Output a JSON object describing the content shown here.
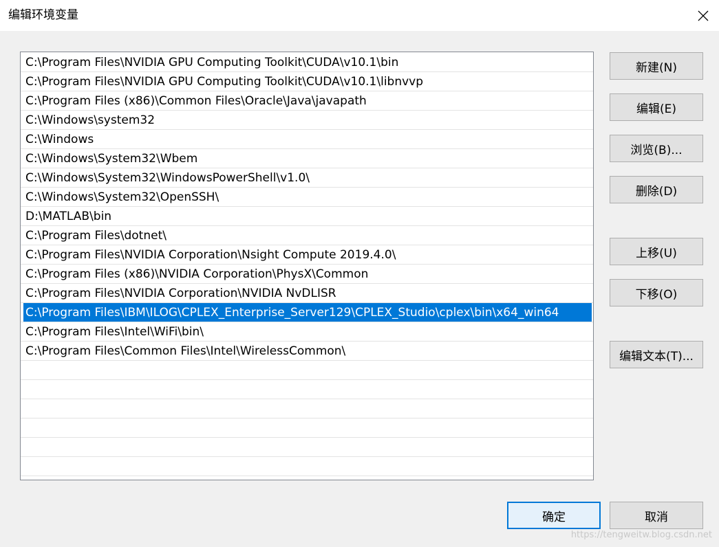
{
  "window": {
    "title": "编辑环境变量",
    "close_icon": "close-icon"
  },
  "path_list": {
    "items": [
      "C:\\Program Files\\NVIDIA GPU Computing Toolkit\\CUDA\\v10.1\\bin",
      "C:\\Program Files\\NVIDIA GPU Computing Toolkit\\CUDA\\v10.1\\libnvvp",
      "C:\\Program Files (x86)\\Common Files\\Oracle\\Java\\javapath",
      "C:\\Windows\\system32",
      "C:\\Windows",
      "C:\\Windows\\System32\\Wbem",
      "C:\\Windows\\System32\\WindowsPowerShell\\v1.0\\",
      "C:\\Windows\\System32\\OpenSSH\\",
      "D:\\MATLAB\\bin",
      "C:\\Program Files\\dotnet\\",
      "C:\\Program Files\\NVIDIA Corporation\\Nsight Compute 2019.4.0\\",
      "C:\\Program Files (x86)\\NVIDIA Corporation\\PhysX\\Common",
      "C:\\Program Files\\NVIDIA Corporation\\NVIDIA NvDLISR",
      "C:\\Program Files\\IBM\\ILOG\\CPLEX_Enterprise_Server129\\CPLEX_Studio\\cplex\\bin\\x64_win64",
      "C:\\Program Files\\Intel\\WiFi\\bin\\",
      "C:\\Program Files\\Common Files\\Intel\\WirelessCommon\\",
      "",
      "",
      "",
      "",
      "",
      "",
      ""
    ],
    "selected_index": 13,
    "selected_color": "#0078d7"
  },
  "buttons": {
    "new": "新建(N)",
    "edit": "编辑(E)",
    "browse": "浏览(B)...",
    "delete": "删除(D)",
    "move_up": "上移(U)",
    "move_down": "下移(O)",
    "edit_text": "编辑文本(T)...",
    "ok": "确定",
    "cancel": "取消"
  },
  "watermark": "https://tengweitw.blog.csdn.net"
}
